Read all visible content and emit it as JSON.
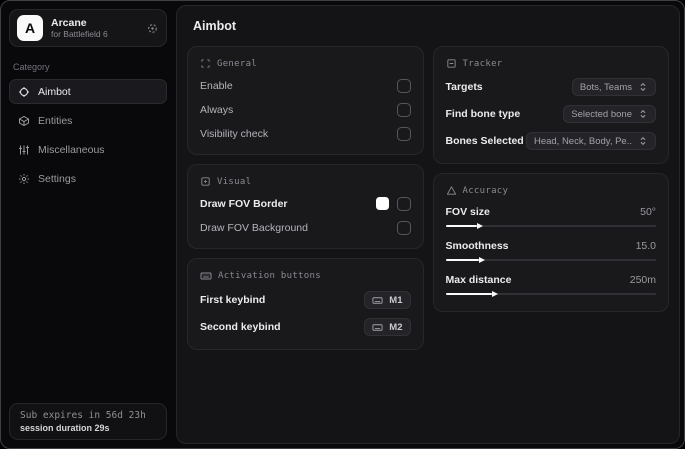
{
  "sidebar": {
    "logo_letter": "A",
    "app_name": "Arcane",
    "app_subtitle": "for Battlefield 6",
    "category_label": "Category",
    "nav": [
      {
        "label": "Aimbot",
        "icon": "crosshair-icon",
        "active": true
      },
      {
        "label": "Entities",
        "icon": "cube-icon",
        "active": false
      },
      {
        "label": "Miscellaneous",
        "icon": "sliders-icon",
        "active": false
      },
      {
        "label": "Settings",
        "icon": "gear-icon",
        "active": false
      }
    ],
    "footer": {
      "line1": "Sub expires in 56d 23h",
      "line2": "session duration 29s"
    }
  },
  "main": {
    "title": "Aimbot",
    "general": {
      "title": "General",
      "rows": [
        {
          "label": "Enable",
          "checked": false
        },
        {
          "label": "Always",
          "checked": false
        },
        {
          "label": "Visibility check",
          "checked": false
        }
      ]
    },
    "visual": {
      "title": "Visual",
      "rows": [
        {
          "label": "Draw FOV Border",
          "swatch_color": "#ffffff",
          "checked": false
        },
        {
          "label": "Draw FOV Background",
          "checked": false
        }
      ]
    },
    "activation": {
      "title": "Activation buttons",
      "rows": [
        {
          "label": "First keybind",
          "key": "M1"
        },
        {
          "label": "Second keybind",
          "key": "M2"
        }
      ]
    },
    "tracker": {
      "title": "Tracker",
      "rows": [
        {
          "label": "Targets",
          "value": "Bots, Teams"
        },
        {
          "label": "Find bone type",
          "value": "Selected bone"
        },
        {
          "label": "Bones Selected",
          "value": "Head, Neck, Body, Pe.."
        }
      ]
    },
    "accuracy": {
      "title": "Accuracy",
      "rows": [
        {
          "label": "FOV size",
          "value": "50°",
          "fill_pct": 15
        },
        {
          "label": "Smoothness",
          "value": "15.0",
          "fill_pct": 16
        },
        {
          "label": "Max distance",
          "value": "250m",
          "fill_pct": 22
        }
      ]
    }
  },
  "colors": {
    "fov_border_swatch": "#ffffff",
    "slider_fill": "#fafafa",
    "panel_bg": "#19191c",
    "window_bg": "#09090b"
  }
}
